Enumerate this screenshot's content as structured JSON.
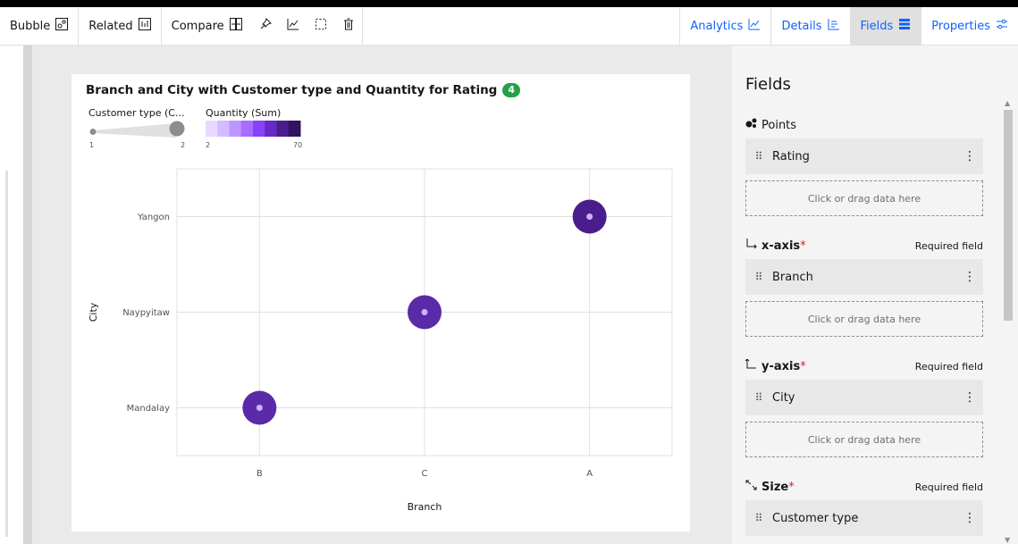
{
  "toolbar": {
    "bubble_label": "Bubble",
    "related_label": "Related",
    "compare_label": "Compare",
    "analytics_label": "Analytics",
    "details_label": "Details",
    "fields_label": "Fields",
    "properties_label": "Properties"
  },
  "card": {
    "title": "Branch and City with Customer type and Quantity for Rating",
    "badge": "4",
    "legend": {
      "size_title": "Customer type (C...",
      "size_min": "1",
      "size_max": "2",
      "color_title": "Quantity (Sum)",
      "color_min": "2",
      "color_max": "70"
    }
  },
  "chart_data": {
    "type": "scatter",
    "xlabel": "Branch",
    "ylabel": "City",
    "x_categories": [
      "B",
      "C",
      "A"
    ],
    "y_categories": [
      "Mandalay",
      "Naypyitaw",
      "Yangon"
    ],
    "points": [
      {
        "x": "B",
        "y": "Mandalay",
        "color": "#5a2aa8"
      },
      {
        "x": "C",
        "y": "Naypyitaw",
        "color": "#5a2aa8"
      },
      {
        "x": "A",
        "y": "Yangon",
        "color": "#4a1d8c"
      }
    ],
    "grid": true,
    "color_scale": [
      "#e8daff",
      "#d4bbff",
      "#be95ff",
      "#a56eff",
      "#8a3ffc",
      "#6929c4",
      "#491d8b",
      "#31135e"
    ]
  },
  "panel": {
    "title": "Fields",
    "points": {
      "label": "Points",
      "field": "Rating",
      "dropzone": "Click or drag data here"
    },
    "xaxis": {
      "label": "x-axis",
      "star": "*",
      "required": "Required field",
      "field": "Branch",
      "dropzone": "Click or drag data here"
    },
    "yaxis": {
      "label": "y-axis",
      "star": "*",
      "required": "Required field",
      "field": "City",
      "dropzone": "Click or drag data here"
    },
    "size": {
      "label": "Size",
      "star": "*",
      "required": "Required field",
      "field": "Customer type"
    }
  }
}
